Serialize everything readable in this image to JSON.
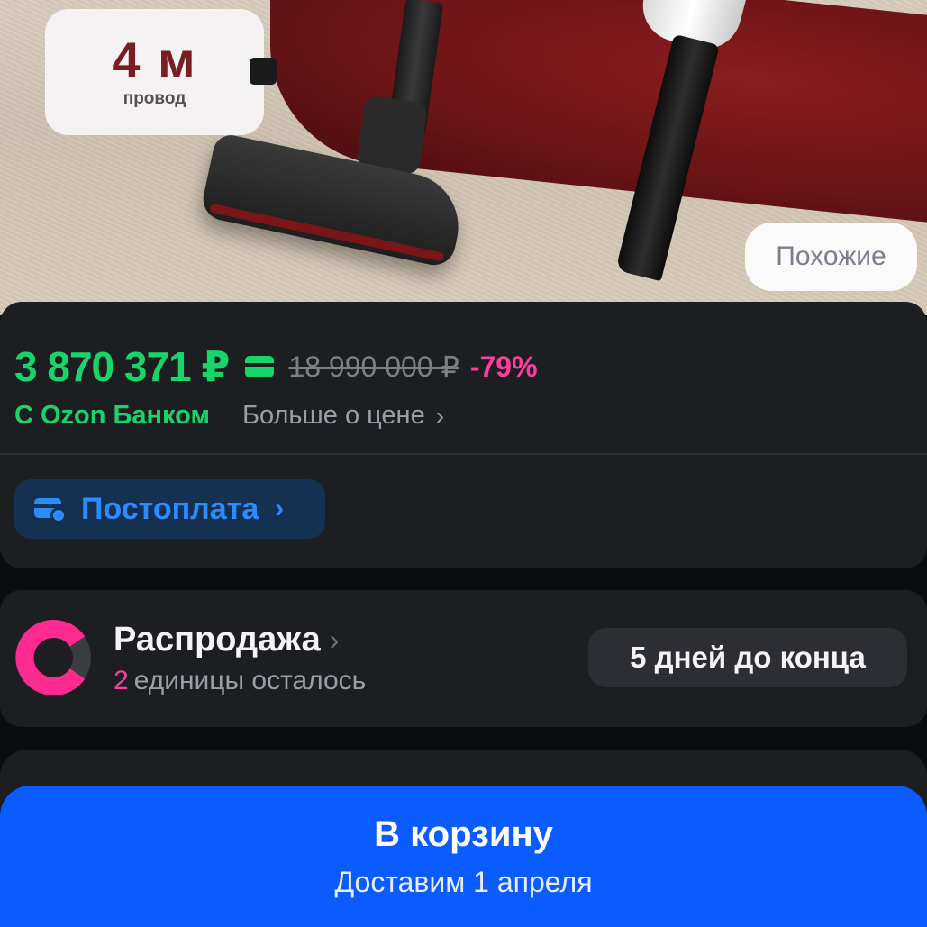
{
  "hero": {
    "badge_value": "4 м",
    "badge_caption": "провод",
    "similar_label": "Похожие"
  },
  "price": {
    "current": "3 870 371 ₽",
    "old": "18 990 000 ₽",
    "discount": "-79%",
    "bank_label": "С Ozon Банком",
    "more_label": "Больше о цене",
    "postpay_label": "Постоплата"
  },
  "sale": {
    "title": "Распродажа",
    "remaining_count": "2",
    "remaining_text": "единицы осталось",
    "days_left": "5 дней до конца"
  },
  "cart": {
    "button_label": "В корзину",
    "delivery_text": "Доставим 1 апреля"
  },
  "colors": {
    "price_green": "#19d46a",
    "discount_pink": "#ff3d9c",
    "accent_blue": "#0a5cff",
    "background": "#1c1e22"
  }
}
